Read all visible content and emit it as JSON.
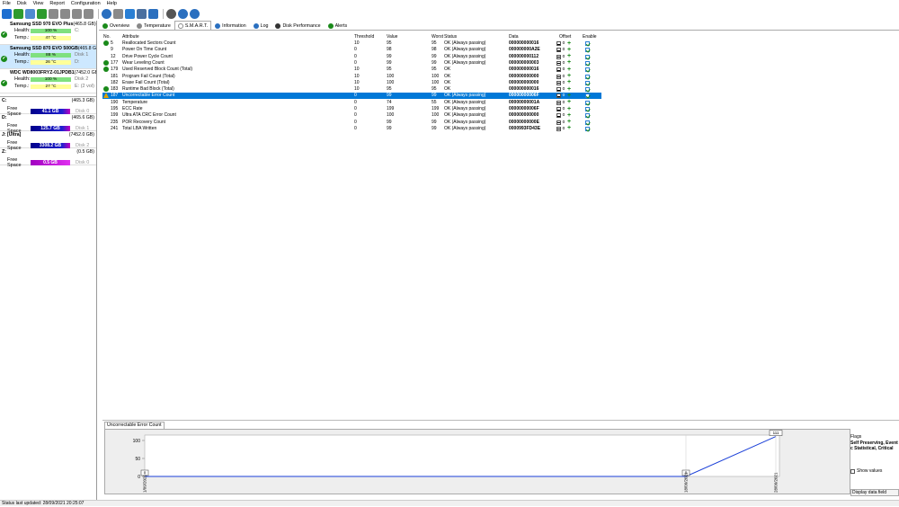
{
  "menu": [
    "File",
    "Disk",
    "View",
    "Report",
    "Configuration",
    "Help"
  ],
  "toolbar_icons": [
    "refresh-icon",
    "smart-icon",
    "drive-icon",
    "checkmark-icon",
    "hammer-icon",
    "hammer-icon",
    "wrench-icon",
    "wrench-icon",
    "globe-icon",
    "trim-icon",
    "refresh-icon",
    "monitor-icon",
    "save-icon",
    "settings-icon",
    "help-icon",
    "info-icon"
  ],
  "disks": [
    {
      "name": "Samsung SSD 970 EVO Plus",
      "size": "(465.8 GB)",
      "health": "100 %",
      "temp": "47 °C",
      "num": "C:"
    },
    {
      "name": "Samsung SSD 870 EVO 500GB",
      "size": "(465.8 GB)",
      "health": "88 %",
      "temp": "26 °C",
      "num": "Disk 1",
      "num2": "D:",
      "selected": true
    },
    {
      "name": "WDC WD8003FRYZ-01JPDB1",
      "size": "(7452.0 GB)",
      "health": "100 %",
      "temp": "27 °C",
      "num": "Disk 2",
      "num2": "E: (2 vol)"
    }
  ],
  "disk_labels": {
    "health": "Health:",
    "temp": "Temp.:"
  },
  "drives": [
    {
      "letter": "C:",
      "size": "(465.3 GB)",
      "free": "41.1 GB",
      "disk": "Disk 0",
      "color": "#00008b"
    },
    {
      "letter": "D:",
      "size": "(465.6 GB)",
      "free": "125.7 GB",
      "disk": "Disk 1",
      "color": "#00008b"
    },
    {
      "letter": "J: [Ultra]",
      "size": "(7452.0 GB)",
      "free": "3308.2 GB",
      "disk": "Disk 2",
      "color": "#00008b"
    },
    {
      "letter": "Z:",
      "size": "(0.5 GB)",
      "free": "0.5 GB",
      "disk": "Disk 0",
      "color": "#a000c0"
    }
  ],
  "free_space_label": "Free Space",
  "tabs": [
    "Overview",
    "Temperature",
    "S.M.A.R.T.",
    "Information",
    "Log",
    "Disk Performance",
    "Alerts"
  ],
  "table_headers": [
    "No.",
    "Attribute",
    "Threshold",
    "Value",
    "Worst",
    "Status",
    "Data",
    "Offset",
    "Enable"
  ],
  "rows": [
    {
      "no": "5",
      "attr": "Reallocated Sectors Count",
      "th": "10",
      "val": "95",
      "worst": "95",
      "status": "OK (Always passing)",
      "data": "000000000016",
      "icon": "ok"
    },
    {
      "no": "9",
      "attr": "Power On Time Count",
      "th": "0",
      "val": "98",
      "worst": "98",
      "status": "OK (Always passing)",
      "data": "000000000A2E",
      "icon": ""
    },
    {
      "no": "12",
      "attr": "Drive Power Cycle Count",
      "th": "0",
      "val": "99",
      "worst": "99",
      "status": "OK (Always passing)",
      "data": "000000000112",
      "icon": ""
    },
    {
      "no": "177",
      "attr": "Wear Leveling Count",
      "th": "0",
      "val": "99",
      "worst": "99",
      "status": "OK (Always passing)",
      "data": "000000000003",
      "icon": "ok"
    },
    {
      "no": "179",
      "attr": "Used Reserved Block Count (Total)",
      "th": "10",
      "val": "95",
      "worst": "95",
      "status": "OK",
      "data": "000000000016",
      "icon": "ok"
    },
    {
      "no": "181",
      "attr": "Program Fail Count (Total)",
      "th": "10",
      "val": "100",
      "worst": "100",
      "status": "OK",
      "data": "000000000000",
      "icon": ""
    },
    {
      "no": "182",
      "attr": "Erase Fail Count (Total)",
      "th": "10",
      "val": "100",
      "worst": "100",
      "status": "OK",
      "data": "000000000000",
      "icon": ""
    },
    {
      "no": "183",
      "attr": "Runtime Bad Block (Total)",
      "th": "10",
      "val": "95",
      "worst": "95",
      "status": "OK",
      "data": "000000000016",
      "icon": "ok"
    },
    {
      "no": "187",
      "attr": "Uncorrectable Error Count",
      "th": "0",
      "val": "99",
      "worst": "99",
      "status": "OK (Always passing)",
      "data": "00000000006F",
      "icon": "warn",
      "hl": true
    },
    {
      "no": "190",
      "attr": "Temperature",
      "th": "0",
      "val": "74",
      "worst": "55",
      "status": "OK (Always passing)",
      "data": "00000000001A",
      "icon": ""
    },
    {
      "no": "195",
      "attr": "ECC Rate",
      "th": "0",
      "val": "199",
      "worst": "199",
      "status": "OK (Always passing)",
      "data": "00000000006F",
      "icon": ""
    },
    {
      "no": "199",
      "attr": "Ultra ATA CRC Error Count",
      "th": "0",
      "val": "100",
      "worst": "100",
      "status": "OK (Always passing)",
      "data": "000000000000",
      "icon": ""
    },
    {
      "no": "235",
      "attr": "POR Recovery Count",
      "th": "0",
      "val": "99",
      "worst": "99",
      "status": "OK (Always passing)",
      "data": "00000000000E",
      "icon": ""
    },
    {
      "no": "241",
      "attr": "Total LBA Written",
      "th": "0",
      "val": "99",
      "worst": "99",
      "status": "OK (Always passing)",
      "data": "0000993FD43E",
      "icon": ""
    }
  ],
  "offset_value": "0",
  "graph": {
    "title": "Uncorrectable Error Count",
    "y_ticks": [
      "100",
      "50",
      "0"
    ],
    "x_labels": [
      "1/09/2021",
      "18/09/2021",
      "28/09/2021"
    ],
    "point_labels": [
      "0",
      "0",
      "111"
    ]
  },
  "chart_data": {
    "type": "line",
    "title": "Uncorrectable Error Count",
    "x": [
      "1/09/2021",
      "18/09/2021",
      "28/09/2021"
    ],
    "values": [
      0,
      0,
      111
    ],
    "ylim": [
      0,
      120
    ]
  },
  "flags": {
    "label": "Flags",
    "value": "Self Preserving, Event c Statistical, Critical",
    "show_values": "Show values",
    "display": "Display data field"
  },
  "status": "Status last updated: 28/09/2021 20:25:07",
  "colors": {
    "selection": "#0078d7",
    "health": "#7fe07f",
    "temp": "#ffff99",
    "ok": "#1a8a1a"
  }
}
